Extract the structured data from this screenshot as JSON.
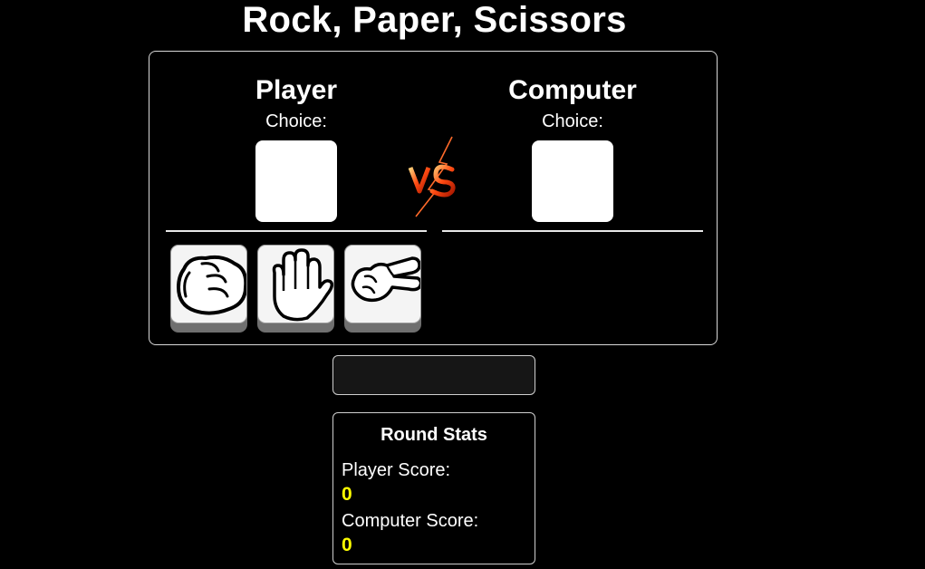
{
  "title": "Rock, Paper, Scissors",
  "player": {
    "name": "Player",
    "choice_label": "Choice:"
  },
  "computer": {
    "name": "Computer",
    "choice_label": "Choice:"
  },
  "vs_icon": "vs-lightning-icon",
  "moves": [
    {
      "name": "rock",
      "icon": "fist-icon"
    },
    {
      "name": "paper",
      "icon": "open-hand-icon"
    },
    {
      "name": "scissors",
      "icon": "peace-hand-icon"
    }
  ],
  "result": {
    "message": ""
  },
  "stats": {
    "title": "Round Stats",
    "player_label": "Player Score:",
    "player_score": "0",
    "computer_label": "Computer Score:",
    "computer_score": "0"
  },
  "colors": {
    "background": "#000000",
    "score": "#ffff00",
    "vs": "#ff5a1f"
  }
}
